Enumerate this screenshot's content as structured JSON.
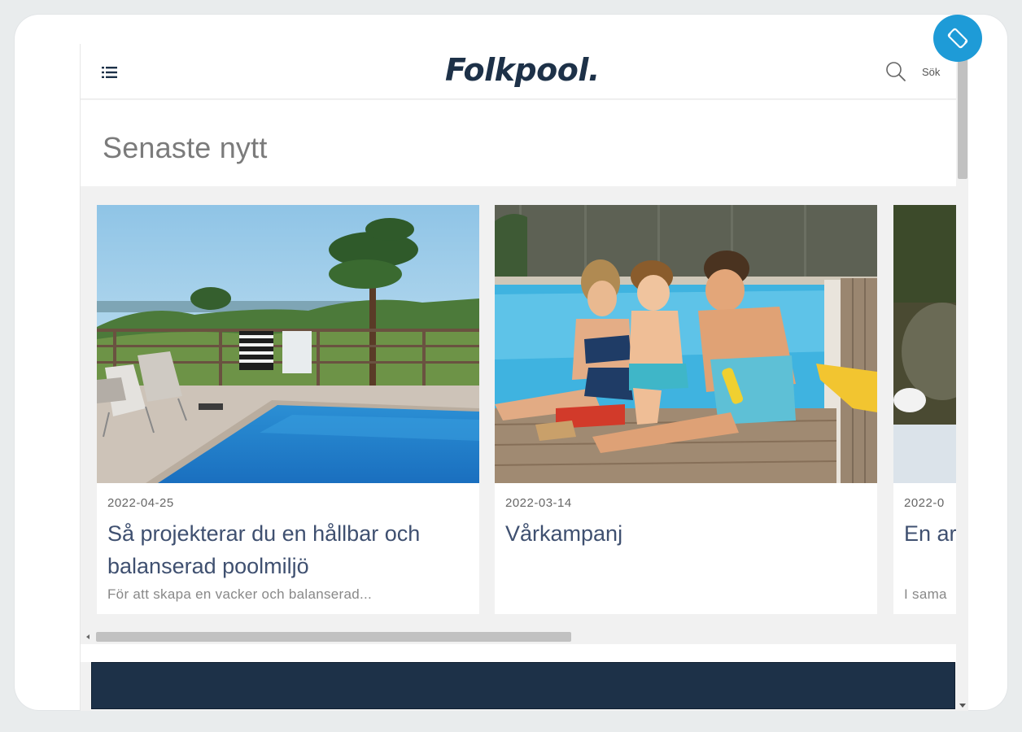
{
  "header": {
    "logo_text": "Folkpool",
    "logo_dot": ".",
    "menu_icon": "hamburger-list-icon",
    "search_icon": "magnifier-icon",
    "search_label": "Sök"
  },
  "page": {
    "title": "Senaste nytt"
  },
  "articles": [
    {
      "date": "2022-04-25",
      "title": "Så projekterar du en hållbar och balanserad poolmiljö",
      "excerpt": "För att skapa en vacker och balanserad..."
    },
    {
      "date": "2022-03-14",
      "title": "Vårkampanj",
      "excerpt": ""
    },
    {
      "date": "2022-0",
      "title": "En ar",
      "excerpt": "I sama"
    }
  ],
  "colors": {
    "brand_navy": "#1d3148",
    "accent_blue": "#1e9bd7",
    "title_text": "#3f5070"
  },
  "device": {
    "rotate_icon": "screen-rotate-icon"
  }
}
